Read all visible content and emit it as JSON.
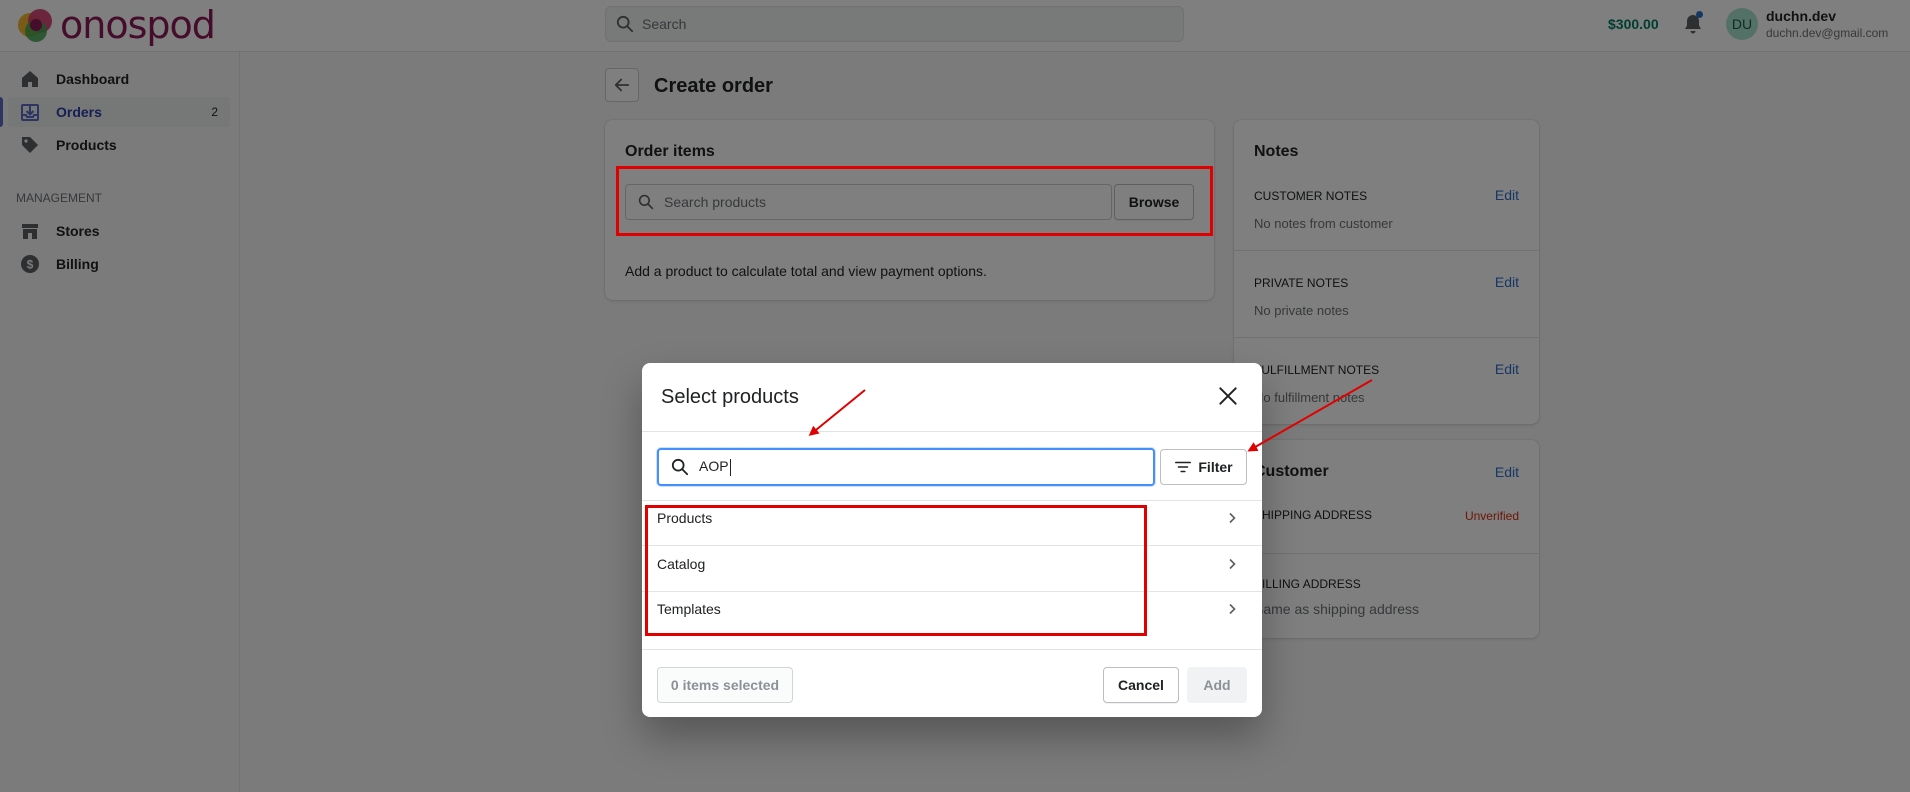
{
  "topbar": {
    "brand": "onospod",
    "search_placeholder": "Search",
    "balance": "$300.00",
    "user": {
      "initials": "DU",
      "name": "duchn.dev",
      "email": "duchn.dev@gmail.com"
    }
  },
  "sidebar": {
    "items": [
      {
        "label": "Dashboard",
        "icon": "home-icon"
      },
      {
        "label": "Orders",
        "icon": "orders-icon",
        "count": "2",
        "active": true
      },
      {
        "label": "Products",
        "icon": "tag-icon"
      }
    ],
    "section_label": "MANAGEMENT",
    "management_items": [
      {
        "label": "Stores",
        "icon": "store-icon"
      },
      {
        "label": "Billing",
        "icon": "dollar-icon"
      }
    ]
  },
  "page": {
    "title": "Create order",
    "order_items": {
      "title": "Order items",
      "search_placeholder": "Search products",
      "browse_label": "Browse",
      "hint": "Add a product to calculate total and view payment options."
    },
    "notes": {
      "title": "Notes",
      "edit_label": "Edit",
      "customer_notes_label": "CUSTOMER NOTES",
      "customer_notes_text": "No notes from customer",
      "private_notes_label": "PRIVATE NOTES",
      "private_notes_text": "No private notes",
      "fulfillment_notes_label": "FULFILLMENT NOTES",
      "fulfillment_notes_text": "No fulfillment notes"
    },
    "customer": {
      "title": "Customer",
      "edit_label": "Edit",
      "shipping_label": "SHIPPING ADDRESS",
      "shipping_status": "Unverified",
      "billing_label": "BILLING ADDRESS",
      "billing_text": "Same as shipping address"
    }
  },
  "modal": {
    "title": "Select products",
    "search_value": "AOP",
    "filter_label": "Filter",
    "rows": [
      "Products",
      "Catalog",
      "Templates"
    ],
    "selected_count": "0 items selected",
    "cancel_label": "Cancel",
    "add_label": "Add"
  },
  "colors": {
    "accent": "#5c6ac4",
    "brand": "#8a1a57",
    "link": "#2c6ecb",
    "annotation": "#e00000",
    "focus": "#458fff",
    "success": "#007f5f"
  }
}
